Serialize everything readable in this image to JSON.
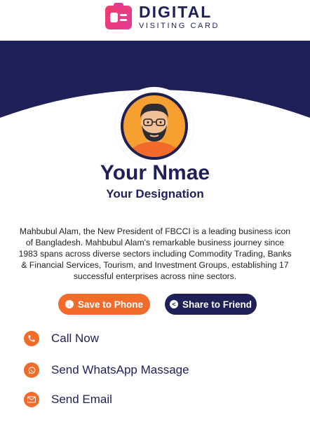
{
  "logo": {
    "main": "DIGITAL",
    "sub": "VISITING CARD"
  },
  "profile": {
    "name": "Your Nmae",
    "designation": "Your Designation",
    "bio": "Mahbubul Alam, the New President of FBCCI is a leading business icon of Bangladesh. Mahbubul Alam's remarkable business journey since 1983 spans across diverse sectors including Commodity Trading, Banks & Financial Services, Tourism, and Investment Groups, establishing 17 successful enterprises across nine sectors."
  },
  "buttons": {
    "save": "Save to Phone",
    "share": "Share to Friend"
  },
  "actions": [
    {
      "label": "Call Now",
      "icon": "phone-icon"
    },
    {
      "label": "Send WhatsApp Massage",
      "icon": "whatsapp-icon"
    },
    {
      "label": "Send Email",
      "icon": "email-icon"
    }
  ],
  "colors": {
    "navy": "#1e2057",
    "orange": "#f26b2a",
    "pink": "#e33b93"
  }
}
